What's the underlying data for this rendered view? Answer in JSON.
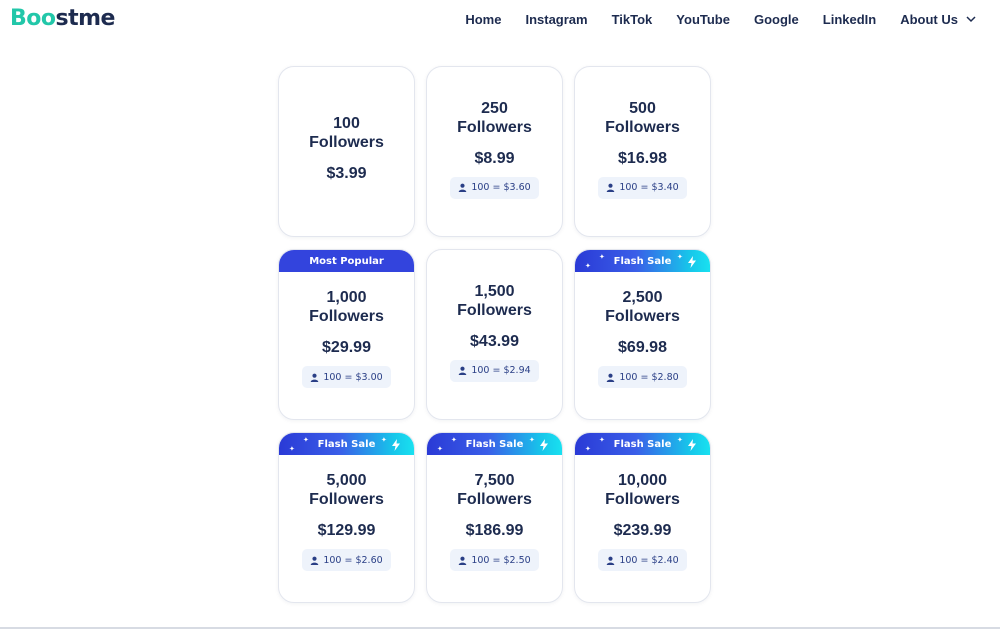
{
  "brand": {
    "part1": "Boo",
    "part2": "st",
    "part3": "me"
  },
  "nav": {
    "items": [
      "Home",
      "Instagram",
      "TikTok",
      "YouTube",
      "Google",
      "LinkedIn",
      "About Us"
    ]
  },
  "packages": [
    {
      "qty": "100",
      "unit": "Followers",
      "price": "$3.99",
      "rate": "",
      "badge": ""
    },
    {
      "qty": "250",
      "unit": "Followers",
      "price": "$8.99",
      "rate": "100 = $3.60",
      "badge": ""
    },
    {
      "qty": "500",
      "unit": "Followers",
      "price": "$16.98",
      "rate": "100 = $3.40",
      "badge": ""
    },
    {
      "qty": "1,000",
      "unit": "Followers",
      "price": "$29.99",
      "rate": "100 = $3.00",
      "badge": "Most Popular"
    },
    {
      "qty": "1,500",
      "unit": "Followers",
      "price": "$43.99",
      "rate": "100 = $2.94",
      "badge": ""
    },
    {
      "qty": "2,500",
      "unit": "Followers",
      "price": "$69.98",
      "rate": "100 = $2.80",
      "badge": "Flash Sale"
    },
    {
      "qty": "5,000",
      "unit": "Followers",
      "price": "$129.99",
      "rate": "100 = $2.60",
      "badge": "Flash Sale"
    },
    {
      "qty": "7,500",
      "unit": "Followers",
      "price": "$186.99",
      "rate": "100 = $2.50",
      "badge": "Flash Sale"
    },
    {
      "qty": "10,000",
      "unit": "Followers",
      "price": "$239.99",
      "rate": "100 = $2.40",
      "badge": "Flash Sale"
    }
  ],
  "colors": {
    "accent": "#22c7a9",
    "navy": "#1d2b4f",
    "popular": "#3344dd",
    "flash_start": "#2a3ad6",
    "flash_end": "#19e1f0"
  },
  "icons": {
    "rate": "user-icon",
    "flash": "lightning-bolt-icon",
    "menu": "chevron-down-icon"
  }
}
